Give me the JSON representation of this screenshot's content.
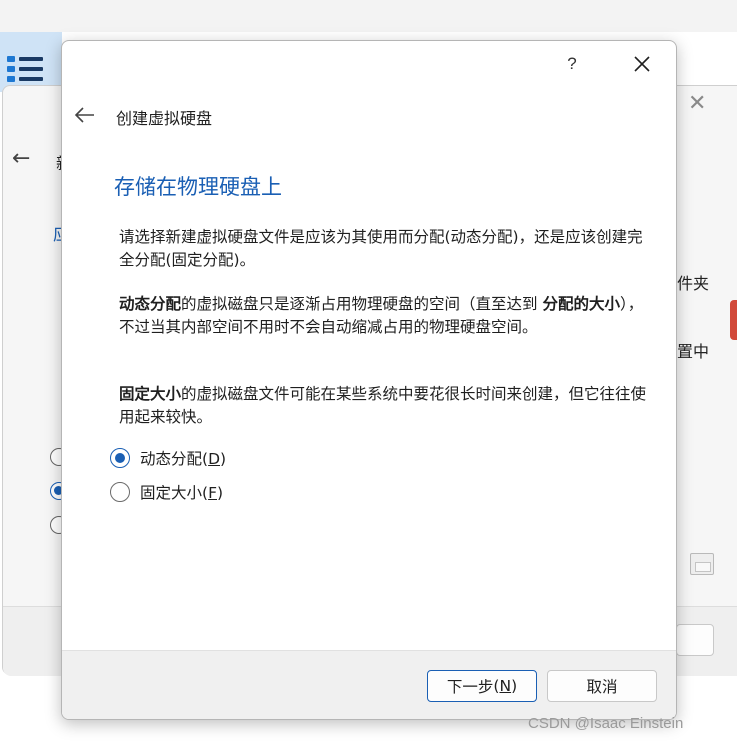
{
  "background": {
    "dialog_fragments": {
      "title_char": "新",
      "heading_char": "应",
      "right_text_1": "件夹",
      "right_text_2": "置中"
    }
  },
  "dialog": {
    "help_label": "?",
    "header_title": "创建虚拟硬盘",
    "page_heading": "存储在物理硬盘上",
    "intro": "请选择新建虚拟硬盘文件是应该为其使用而分配(动态分配)，还是应该创建完全分配(固定分配)。",
    "dynamic_desc": {
      "bold_term": "动态分配",
      "text_before_size": "的虚拟磁盘只是逐渐占用物理硬盘的空间（直至达到",
      "bold_size": "分配的大小",
      "text_after_size": "），不过当其内部空间不用时不会自动缩减占用的物理硬盘空间。"
    },
    "fixed_desc": {
      "bold_term": "固定大小",
      "text": "的虚拟磁盘文件可能在某些系统中要花很长时间来创建，但它往往使用起来较快。"
    },
    "options": [
      {
        "label": "动态分配",
        "mnemonic": "D",
        "checked": true
      },
      {
        "label": "固定大小",
        "mnemonic": "F",
        "checked": false
      }
    ],
    "buttons": {
      "next_label": "下一步",
      "next_mnemonic": "N",
      "cancel_label": "取消"
    }
  },
  "watermark": "CSDN @Isaac Einstein",
  "colors": {
    "accent": "#1a5fb4",
    "footer_bg": "#f0f0f0"
  }
}
